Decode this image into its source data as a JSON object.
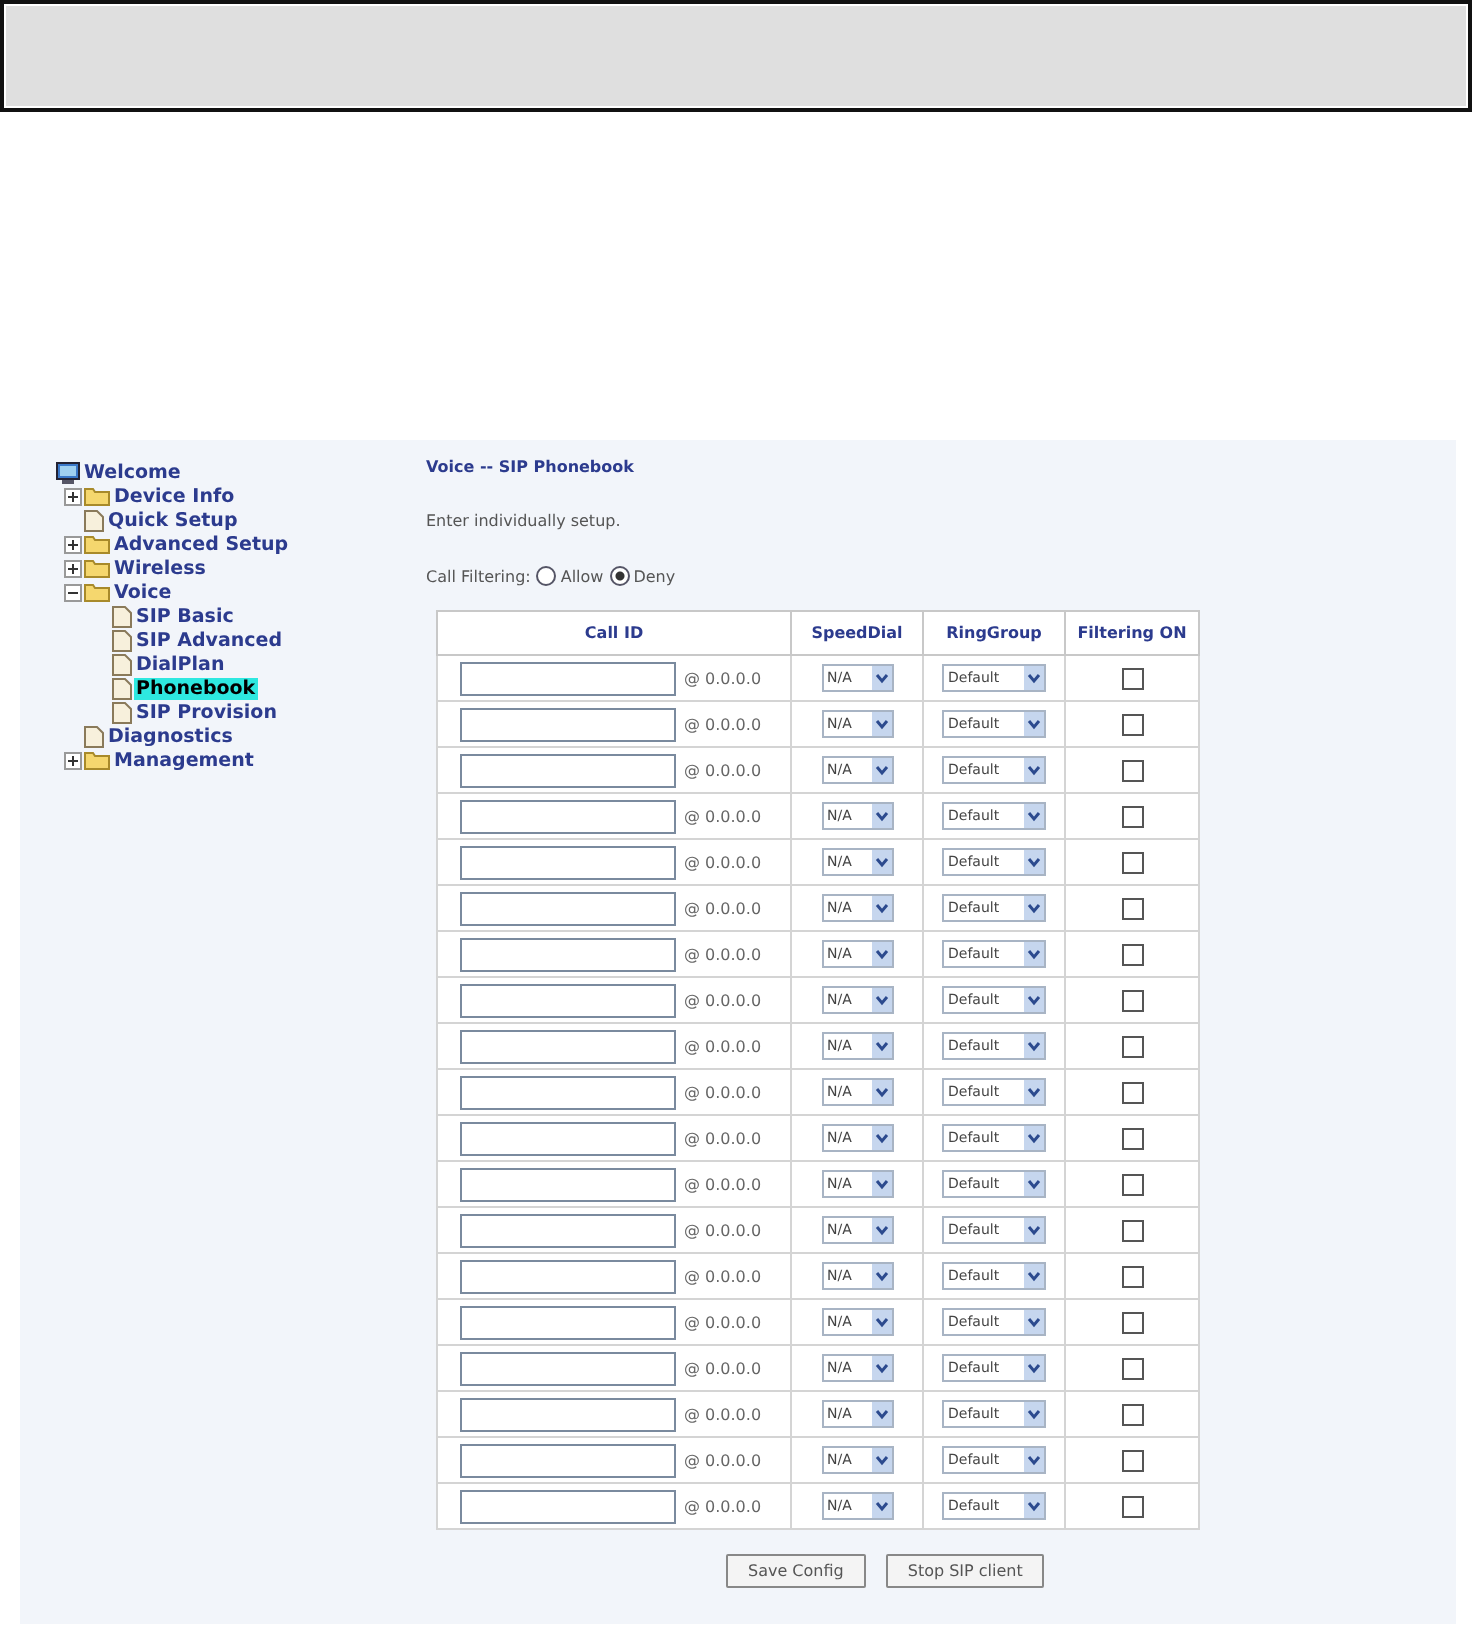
{
  "tree": {
    "label": "Welcome",
    "kind": "root",
    "selected": false,
    "children": [
      {
        "label": "Device Info",
        "kind": "folder",
        "expanded": false,
        "selected": false
      },
      {
        "label": "Quick Setup",
        "kind": "page",
        "selected": false
      },
      {
        "label": "Advanced Setup",
        "kind": "folder",
        "expanded": false,
        "selected": false
      },
      {
        "label": "Wireless",
        "kind": "folder",
        "expanded": false,
        "selected": false
      },
      {
        "label": "Voice",
        "kind": "folder",
        "expanded": true,
        "selected": false,
        "children": [
          {
            "label": "SIP Basic",
            "kind": "page",
            "selected": false
          },
          {
            "label": "SIP Advanced",
            "kind": "page",
            "selected": false
          },
          {
            "label": "DialPlan",
            "kind": "page",
            "selected": false
          },
          {
            "label": "Phonebook",
            "kind": "page",
            "selected": true
          },
          {
            "label": "SIP Provision",
            "kind": "page",
            "selected": false
          }
        ]
      },
      {
        "label": "Diagnostics",
        "kind": "page",
        "selected": false
      },
      {
        "label": "Management",
        "kind": "folder",
        "expanded": false,
        "selected": false
      }
    ]
  },
  "title": "Voice -- SIP Phonebook",
  "intro": "Enter individually setup.",
  "call_filtering": {
    "label": "Call Filtering:",
    "options": [
      {
        "label": "Allow",
        "selected": false
      },
      {
        "label": "Deny",
        "selected": true
      }
    ]
  },
  "table": {
    "columns": [
      "Call ID",
      "SpeedDial",
      "RingGroup",
      "Filtering ON"
    ],
    "rows": [
      {
        "address": "@ 0.0.0.0",
        "speed_dial": "N/A",
        "ring_group": "Default",
        "filtering": false
      },
      {
        "address": "@ 0.0.0.0",
        "speed_dial": "N/A",
        "ring_group": "Default",
        "filtering": false
      },
      {
        "address": "@ 0.0.0.0",
        "speed_dial": "N/A",
        "ring_group": "Default",
        "filtering": false
      },
      {
        "address": "@ 0.0.0.0",
        "speed_dial": "N/A",
        "ring_group": "Default",
        "filtering": false
      },
      {
        "address": "@ 0.0.0.0",
        "speed_dial": "N/A",
        "ring_group": "Default",
        "filtering": false
      },
      {
        "address": "@ 0.0.0.0",
        "speed_dial": "N/A",
        "ring_group": "Default",
        "filtering": false
      },
      {
        "address": "@ 0.0.0.0",
        "speed_dial": "N/A",
        "ring_group": "Default",
        "filtering": false
      },
      {
        "address": "@ 0.0.0.0",
        "speed_dial": "N/A",
        "ring_group": "Default",
        "filtering": false
      },
      {
        "address": "@ 0.0.0.0",
        "speed_dial": "N/A",
        "ring_group": "Default",
        "filtering": false
      },
      {
        "address": "@ 0.0.0.0",
        "speed_dial": "N/A",
        "ring_group": "Default",
        "filtering": false
      },
      {
        "address": "@ 0.0.0.0",
        "speed_dial": "N/A",
        "ring_group": "Default",
        "filtering": false
      },
      {
        "address": "@ 0.0.0.0",
        "speed_dial": "N/A",
        "ring_group": "Default",
        "filtering": false
      },
      {
        "address": "@ 0.0.0.0",
        "speed_dial": "N/A",
        "ring_group": "Default",
        "filtering": false
      },
      {
        "address": "@ 0.0.0.0",
        "speed_dial": "N/A",
        "ring_group": "Default",
        "filtering": false
      },
      {
        "address": "@ 0.0.0.0",
        "speed_dial": "N/A",
        "ring_group": "Default",
        "filtering": false
      },
      {
        "address": "@ 0.0.0.0",
        "speed_dial": "N/A",
        "ring_group": "Default",
        "filtering": false
      },
      {
        "address": "@ 0.0.0.0",
        "speed_dial": "N/A",
        "ring_group": "Default",
        "filtering": false
      },
      {
        "address": "@ 0.0.0.0",
        "speed_dial": "N/A",
        "ring_group": "Default",
        "filtering": false
      },
      {
        "address": "@ 0.0.0.0",
        "speed_dial": "N/A",
        "ring_group": "Default",
        "filtering": false
      }
    ]
  },
  "buttons": [
    "Save Config",
    "Stop SIP client"
  ]
}
